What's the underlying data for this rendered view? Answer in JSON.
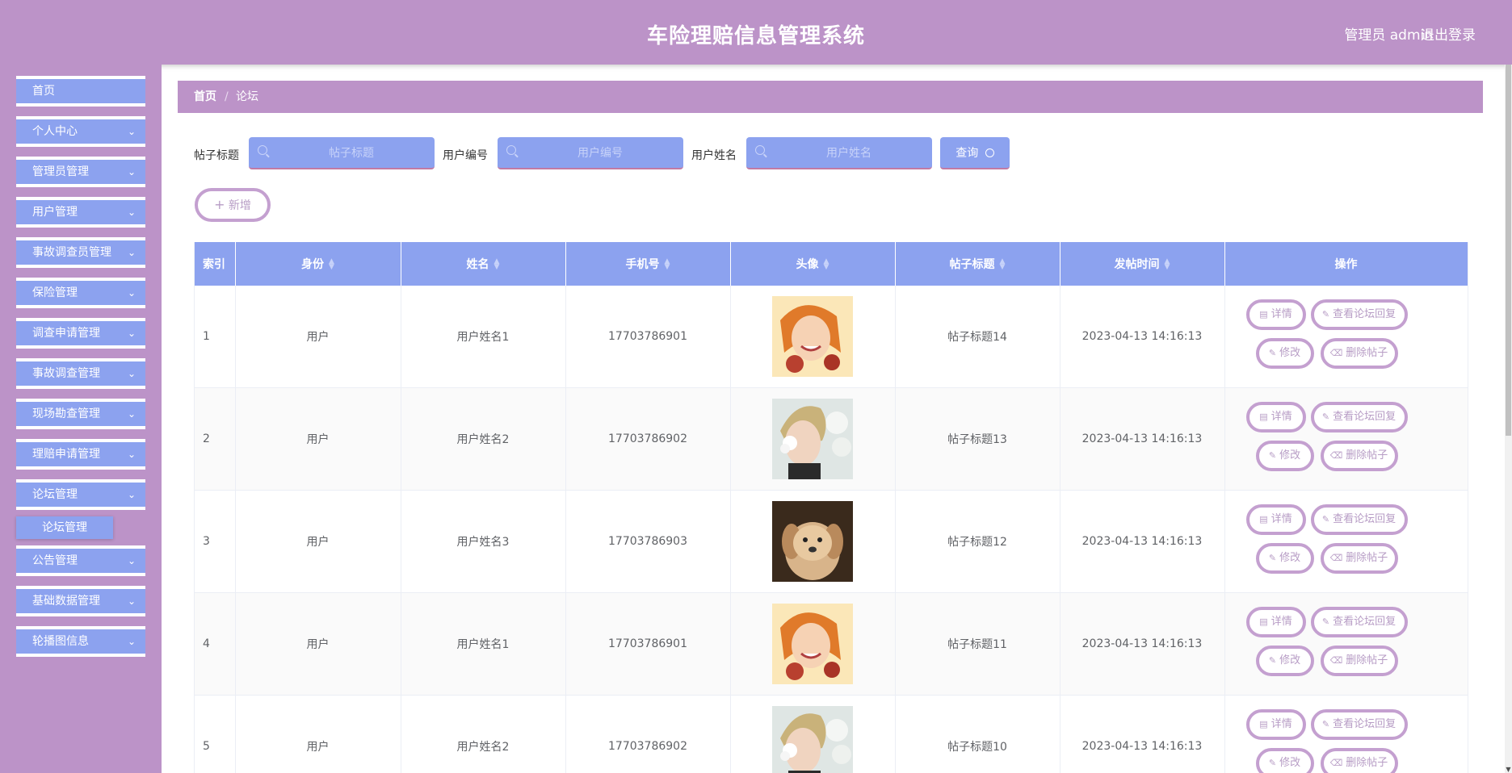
{
  "header": {
    "title": "车险理赔信息管理系统",
    "user": "管理员 admin",
    "logout": "退出登录"
  },
  "sidebar": {
    "items": [
      {
        "label": "首页",
        "has_children": false
      },
      {
        "label": "个人中心",
        "has_children": true
      },
      {
        "label": "管理员管理",
        "has_children": true
      },
      {
        "label": "用户管理",
        "has_children": true
      },
      {
        "label": "事故调查员管理",
        "has_children": true
      },
      {
        "label": "保险管理",
        "has_children": true
      },
      {
        "label": "调查申请管理",
        "has_children": true
      },
      {
        "label": "事故调查管理",
        "has_children": true
      },
      {
        "label": "现场勘查管理",
        "has_children": true
      },
      {
        "label": "理赔申请管理",
        "has_children": true
      },
      {
        "label": "论坛管理",
        "has_children": true,
        "expanded": true
      },
      {
        "label": "公告管理",
        "has_children": true
      },
      {
        "label": "基础数据管理",
        "has_children": true
      },
      {
        "label": "轮播图信息",
        "has_children": true
      }
    ],
    "active_submenu": "论坛管理"
  },
  "breadcrumb": {
    "home": "首页",
    "separator": "/",
    "current": "论坛"
  },
  "search": {
    "title_label": "帖子标题",
    "title_placeholder": "帖子标题",
    "user_no_label": "用户编号",
    "user_no_placeholder": "用户编号",
    "user_name_label": "用户姓名",
    "user_name_placeholder": "用户姓名",
    "query_button": "查询"
  },
  "toolbar": {
    "add_button": "新增"
  },
  "table": {
    "columns": [
      "索引",
      "身份",
      "姓名",
      "手机号",
      "头像",
      "帖子标题",
      "发帖时间",
      "操作"
    ],
    "rows": [
      {
        "index": "1",
        "role": "用户",
        "name": "用户姓名1",
        "phone": "17703786901",
        "avatar": "girl-portrait",
        "title": "帖子标题14",
        "time": "2023-04-13 14:16:13"
      },
      {
        "index": "2",
        "role": "用户",
        "name": "用户姓名2",
        "phone": "17703786902",
        "avatar": "boy-with-flowers",
        "title": "帖子标题13",
        "time": "2023-04-13 14:16:13"
      },
      {
        "index": "3",
        "role": "用户",
        "name": "用户姓名3",
        "phone": "17703786903",
        "avatar": "puppy",
        "title": "帖子标题12",
        "time": "2023-04-13 14:16:13"
      },
      {
        "index": "4",
        "role": "用户",
        "name": "用户姓名1",
        "phone": "17703786901",
        "avatar": "girl-portrait",
        "title": "帖子标题11",
        "time": "2023-04-13 14:16:13"
      },
      {
        "index": "5",
        "role": "用户",
        "name": "用户姓名2",
        "phone": "17703786902",
        "avatar": "boy-with-flowers",
        "title": "帖子标题10",
        "time": "2023-04-13 14:16:13"
      }
    ],
    "actions": {
      "detail": "详情",
      "view_replies": "查看论坛回复",
      "edit": "修改",
      "delete": "删除帖子"
    }
  },
  "colors": {
    "header_bg": "#bc93c8",
    "accent_blue": "#8ca2ef",
    "button_border": "#c4a0d0"
  }
}
